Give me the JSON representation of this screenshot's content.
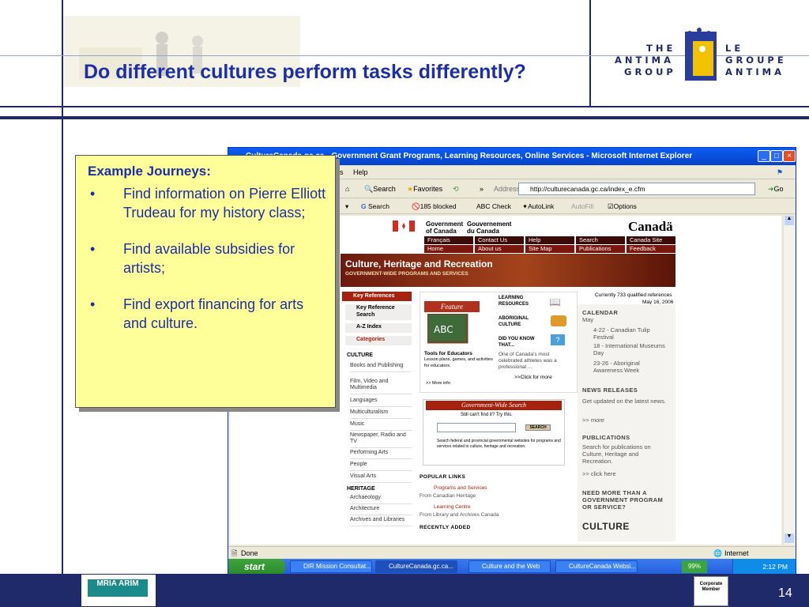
{
  "slide": {
    "title": "Do different cultures perform tasks differently?",
    "page_number": "14"
  },
  "logo": {
    "left_words": [
      "THE",
      "ANTIMA",
      "GROUP"
    ],
    "right_words": [
      "LE",
      "GROUPE",
      "ANTIMA"
    ]
  },
  "note": {
    "title": "Example Journeys:",
    "bullet_char": "•",
    "items": [
      "Find information on Pierre Elliott Trudeau for my history class;",
      "Find available  subsidies for artists;",
      "Find export financing for arts and culture."
    ]
  },
  "browser": {
    "window_title": "CultureCanada.gc.ca - Government Grant Programs, Learning Resources, Online Services - Microsoft Internet Explorer",
    "menu": [
      "ols",
      "Help"
    ],
    "toolbar": {
      "search": "Search",
      "favorites": "Favorites",
      "address_label": "Address",
      "address": "http://culturecanada.gc.ca/index_e.cfm",
      "go": "Go"
    },
    "googlebar": {
      "search": "Search",
      "blocked": "185 blocked",
      "check": "Check",
      "autolink": "AutoLink",
      "autofill": "AutoFill",
      "options": "Options"
    },
    "status": "Done",
    "zone": "Internet"
  },
  "page": {
    "gov_en": "Government of Canada",
    "gov_fr": "Gouvernement du Canada",
    "wordmark": "Canadä",
    "nav_row1": [
      "Français",
      "Contact Us",
      "Help",
      "Search",
      "Canada Site"
    ],
    "nav_row2": [
      "Home",
      "About us",
      "Site Map",
      "Publications",
      "Feedback"
    ],
    "banner_title": "Culture, Heritage and Recreation",
    "banner_sub": "GOVERNMENT-WIDE PROGRAMS AND SERVICES",
    "qualified": "Currently 733 qualified references",
    "date": "May 16, 2006",
    "key_refs": "Key References",
    "key_ref_search": "Key Reference Search",
    "az_index": "A-Z Index",
    "categories": "Categories",
    "culture_head": "CULTURE",
    "culture_links": [
      "Books and Publishing",
      "Film, Video and Multimedia",
      "Languages",
      "Multiculturalism",
      "Music",
      "Newspaper, Radio and TV",
      "Performing Arts",
      "People",
      "Visual Arts"
    ],
    "heritage_head": "HERITAGE",
    "heritage_links": [
      "Archaeology",
      "Architecture",
      "Archives and Libraries"
    ],
    "feature": "Feature",
    "tools_title": "Tools for Educators",
    "tools_text": "Lesson plans, games, and activities for educators.",
    "more_info": ">> More info",
    "learning": "LEARNING RESOURCES",
    "aboriginal": "ABORIGINAL CULTURE",
    "did_you": "DID YOU KNOW THAT...",
    "did_text": "One of Canada's most celebrated athletes was a professional ...",
    "click_more": ">>Click for more",
    "gws_title": "Government-Wide Search",
    "gws_sub": "Still can't find it? Try this.",
    "search_btn": "SEARCH",
    "gws_text": "Search federal and provincial governmental websites for programs and services related to culture, heritage and recreation.",
    "popular": "POPULAR LINKS",
    "pop1": "Programs and Services",
    "pop1_from": "From Canadian Heritage",
    "pop2": "Learning Centre",
    "pop2_from": "From Library and Archives Canada",
    "recent": "RECENTLY ADDED",
    "calendar": "CALENDAR",
    "may": "May",
    "cal1": "4-22 - Canadian Tulip Festival",
    "cal2": "18 - International Museums Day",
    "cal3": "23-26 - Aboriginal Awareness Week",
    "news": "NEWS RELEASES",
    "news_text": "Get updated on the latest news.",
    "more": ">> more",
    "pubs": "PUBLICATIONS",
    "pubs_text": "Search for publications on Culture, Heritage and Recreation.",
    "click_here": ">> click here",
    "need_more": "NEED MORE THAN A GOVERNMENT PROGRAM OR SERVICE?",
    "culture_logo": "CULTURE"
  },
  "taskbar": {
    "start": "start",
    "tasks": [
      "DIR Mission Consultat...",
      "CultureCanada.gc.ca...",
      "Culture and the Web",
      "CultureCanada Websi..."
    ],
    "zoom": "99%",
    "time": "2:12 PM"
  },
  "footer": {
    "corp_badge": "Corporate Member",
    "mria": "MRIA ARIM"
  },
  "colors": {
    "title_blue": "#1c2fa8",
    "navy": "#1f2a6b",
    "note_yellow": "#ffff99",
    "gov_red": "#7a1610"
  }
}
